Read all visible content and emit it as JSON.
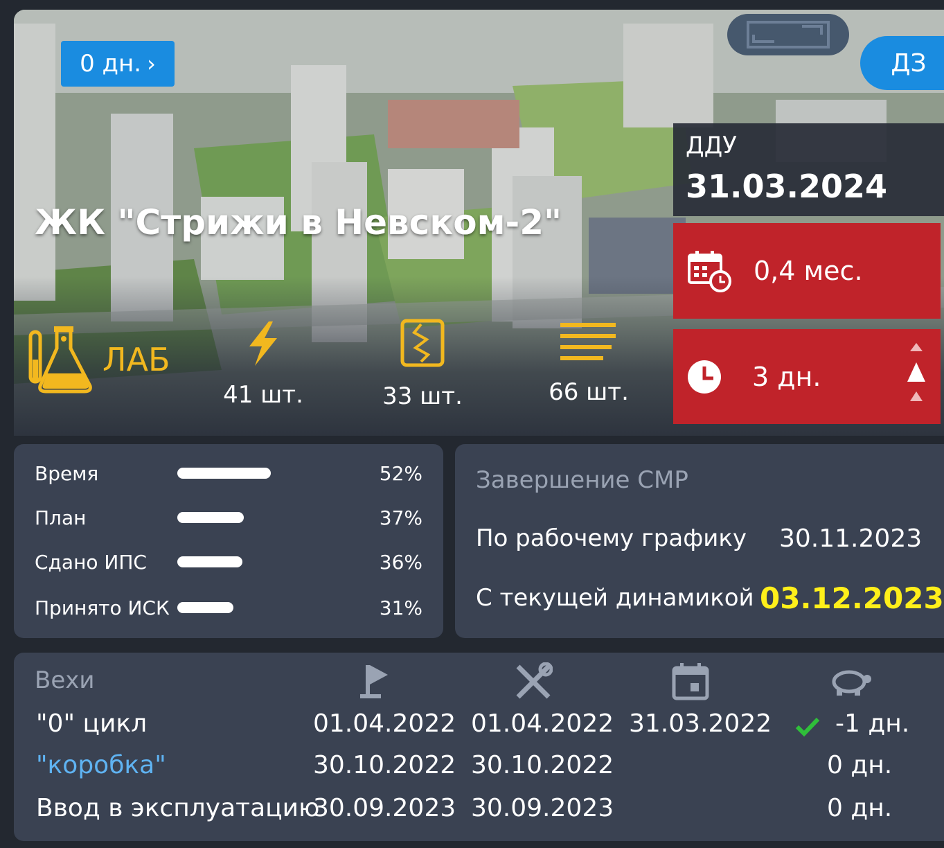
{
  "hero": {
    "days_button": "0 дн.",
    "days_chevron": "›",
    "dz_button": "ДЗ",
    "title": "ЖК \"Стрижи в Невском-2\"",
    "lab_label": "ЛАБ",
    "stats": [
      {
        "icon": "lightning-icon",
        "value": "41 шт."
      },
      {
        "icon": "cracked-wall-icon",
        "value": "33 шт."
      },
      {
        "icon": "lines-list-icon",
        "value": "66 шт."
      }
    ]
  },
  "ddu": {
    "label": "ДДУ",
    "date": "31.03.2024",
    "delay_months": "0,4 мес.",
    "delay_days": "3 дн."
  },
  "progress": [
    {
      "label": "Время",
      "value": 0.52,
      "pct": "52%"
    },
    {
      "label": "План",
      "value": 0.37,
      "pct": "37%"
    },
    {
      "label": "Сдано ИПС",
      "value": 0.36,
      "pct": "36%"
    },
    {
      "label": "Принято ИСК",
      "value": 0.31,
      "pct": "31%"
    }
  ],
  "smr": {
    "title": "Завершение СМР",
    "rows": [
      {
        "label": "По рабочему графику",
        "value": "30.11.2023"
      },
      {
        "label": "С текущей динамикой",
        "value": "03.12.2023"
      }
    ]
  },
  "milestones": {
    "title": "Вехи",
    "column_icons": [
      "flag-icon",
      "tools-icon",
      "calendar-icon",
      "turtle-icon"
    ],
    "rows": [
      {
        "name": "\"0\" цикл",
        "c1": "01.04.2022",
        "c2": "01.04.2022",
        "c3": "31.03.2022",
        "delta": "-1 дн.",
        "done": true
      },
      {
        "name": "\"коробка\"",
        "c1": "30.10.2022",
        "c2": "30.10.2022",
        "c3": "",
        "delta": "0 дн.",
        "done": false
      },
      {
        "name": "Ввод в эксплуатацию",
        "c1": "30.09.2023",
        "c2": "30.09.2023",
        "c3": "",
        "delta": "0 дн.",
        "done": false
      }
    ]
  },
  "colors": {
    "accent_blue": "#1a8ce0",
    "alert_red": "#c0232a",
    "highlight_yellow": "#ffef1a",
    "lab_gold": "#f2b81f",
    "panel_bg": "#3a4252"
  }
}
